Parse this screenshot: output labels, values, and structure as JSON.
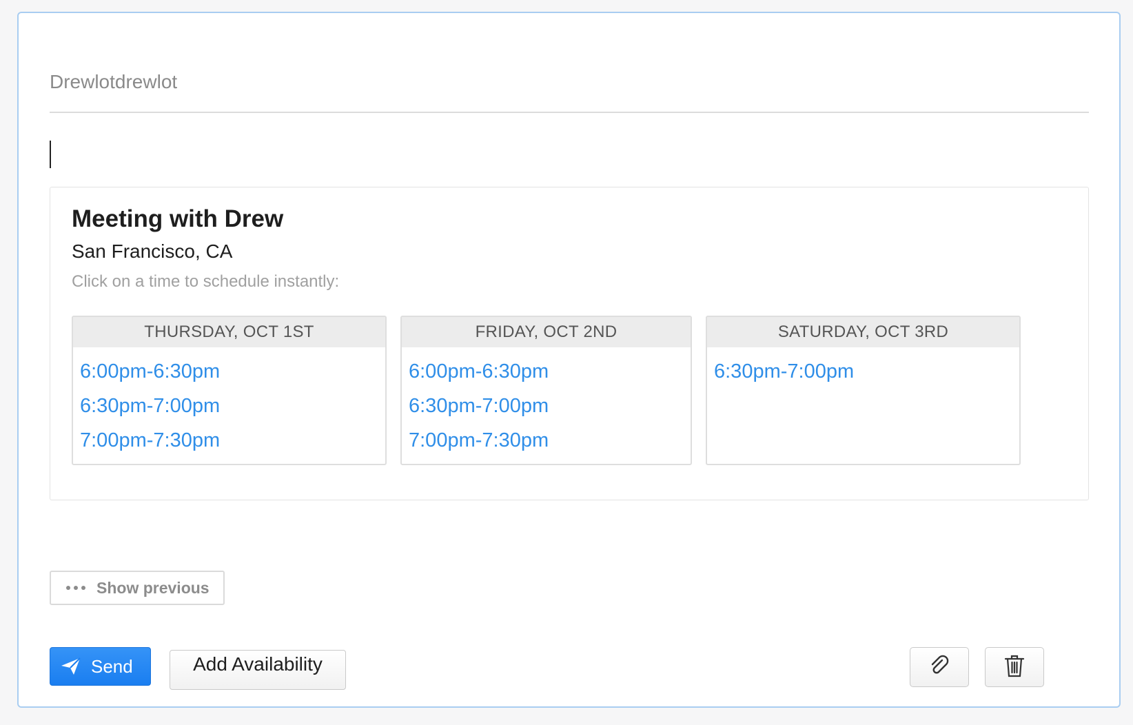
{
  "composer": {
    "to_text": "Drewlotdrewlot"
  },
  "card": {
    "title": "Meeting with Drew",
    "location": "San Francisco, CA",
    "instruction": "Click on a time to schedule instantly:",
    "days": [
      {
        "label": "THURSDAY, OCT 1ST",
        "slots": [
          "6:00pm-6:30pm",
          "6:30pm-7:00pm",
          "7:00pm-7:30pm"
        ]
      },
      {
        "label": "FRIDAY, OCT 2ND",
        "slots": [
          "6:00pm-6:30pm",
          "6:30pm-7:00pm",
          "7:00pm-7:30pm"
        ]
      },
      {
        "label": "SATURDAY, OCT 3RD",
        "slots": [
          "6:30pm-7:00pm"
        ]
      }
    ]
  },
  "show_previous_label": "Show previous",
  "toolbar": {
    "send_label": "Send",
    "add_availability_label": "Add Availability",
    "attach_icon": "paperclip-icon",
    "delete_icon": "trash-icon"
  },
  "colors": {
    "accent": "#1a7ef0",
    "slot_link": "#2f8ee8",
    "border_focus": "#a9cdf1"
  }
}
